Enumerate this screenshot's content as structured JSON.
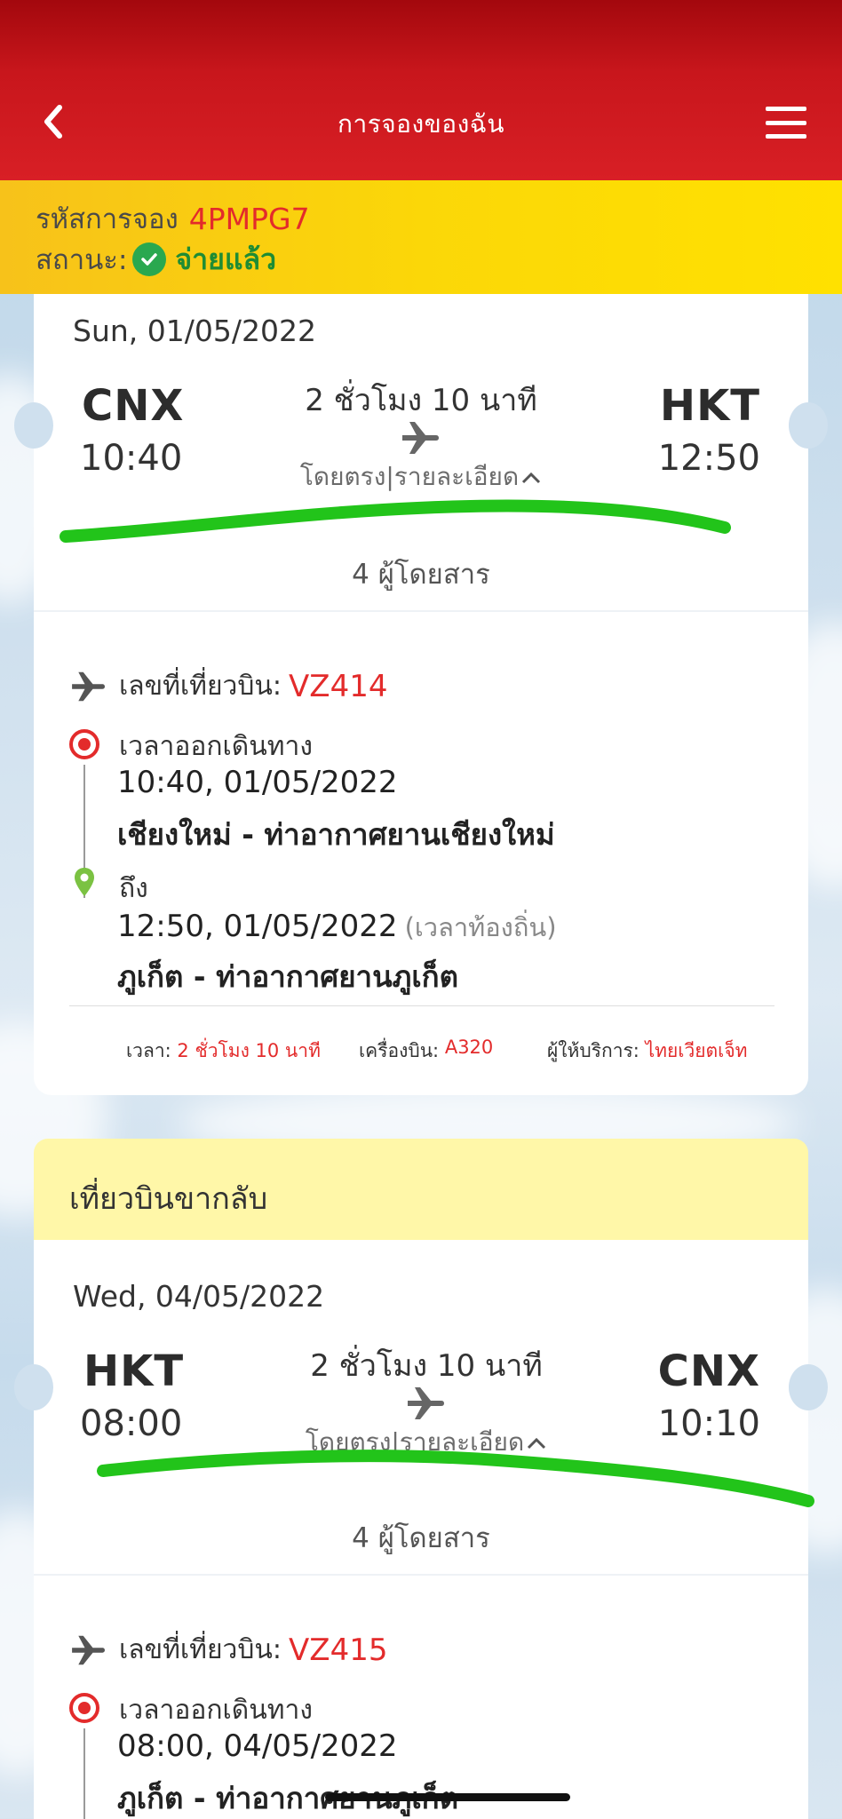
{
  "header": {
    "title": "การจองของฉัน"
  },
  "booking": {
    "code_label": "รหัสการจอง",
    "code": "4PMPG7",
    "status_label": "สถานะ:",
    "status": "จ่ายแล้ว"
  },
  "outbound": {
    "date": "Sun, 01/05/2022",
    "from_code": "CNX",
    "from_time": "10:40",
    "to_code": "HKT",
    "to_time": "12:50",
    "duration": "2 ชั่วโมง 10 นาที",
    "direct_details": "โดยตรง|รายละเอียด",
    "passengers": "4 ผู้โดยสาร",
    "flight_label": "เลขที่เที่ยวบิน:",
    "flight_number": "VZ414",
    "depart_label": "เวลาออกเดินทาง",
    "depart_datetime": "10:40, 01/05/2022",
    "depart_place": "เชียงใหม่ - ท่าอากาศยานเชียงใหม่",
    "arrive_label": "ถึง",
    "arrive_datetime": "12:50, 01/05/2022",
    "arrive_local": "(เวลาท้องถิ่น)",
    "arrive_place": "ภูเก็ต - ท่าอากาศยานภูเก็ต",
    "time_label": "เวลา:",
    "time_value": "2 ชั่วโมง 10 นาที",
    "aircraft_label": "เครื่องบิน:",
    "aircraft_value": "A320",
    "operator_label": "ผู้ให้บริการ:",
    "operator_value": "ไทยเวียตเจ็ท"
  },
  "return_banner": "เที่ยวบินขากลับ",
  "inbound": {
    "date": "Wed, 04/05/2022",
    "from_code": "HKT",
    "from_time": "08:00",
    "to_code": "CNX",
    "to_time": "10:10",
    "duration": "2 ชั่วโมง 10 นาที",
    "direct_details": "โดยตรง|รายละเอียด",
    "passengers": "4 ผู้โดยสาร",
    "flight_label": "เลขที่เที่ยวบิน:",
    "flight_number": "VZ415",
    "depart_label": "เวลาออกเดินทาง",
    "depart_datetime": "08:00, 04/05/2022",
    "depart_place": "ภูเก็ต - ท่าอากาศยานภูเก็ต"
  },
  "colors": {
    "header_red": "#d81f25",
    "accent_red": "#e32b2b",
    "paid_green": "#1e8c34",
    "banner_yellow": "#fbd708",
    "return_banner": "#fff7a8",
    "marker_green": "#22c41a"
  },
  "icons": {
    "back": "chevron-left-icon",
    "menu": "hamburger-menu-icon",
    "paid": "check-circle-icon",
    "plane": "airplane-icon",
    "depart": "target-dot-icon",
    "arrive": "map-pin-icon",
    "expand": "chevron-up-icon"
  }
}
